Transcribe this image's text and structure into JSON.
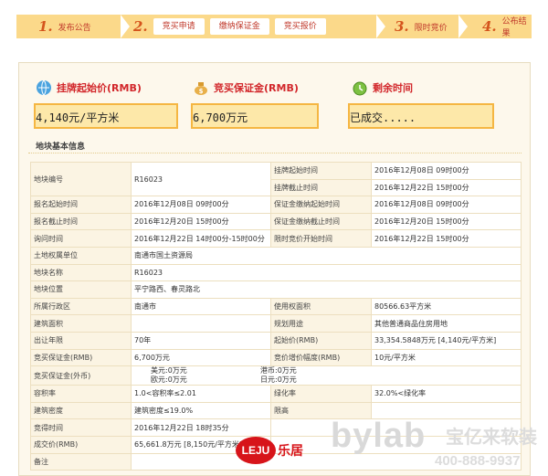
{
  "steps": [
    {
      "num": "1.",
      "label": "发布公告"
    },
    {
      "num": "2.",
      "label": ""
    },
    {
      "num": "3.",
      "label": "限时竞价"
    },
    {
      "num": "4.",
      "label": "公布结果"
    }
  ],
  "step2_buttons": [
    "竞买申请",
    "缴纳保证金",
    "竞买报价"
  ],
  "summary": {
    "start_price_title": "挂牌起始价(RMB)",
    "start_price_value": "4,140元/平方米",
    "deposit_title": "竞买保证金(RMB)",
    "deposit_value": "6,700万元",
    "remaining_title": "剩余时间",
    "remaining_value": "已成交....."
  },
  "section_title": "地块基本信息",
  "table": {
    "parcel_no_k": "地块编号",
    "parcel_no_v": "R16023",
    "list_start_k": "挂牌起始时间",
    "list_start_v": "2016年12月08日 09时00分",
    "list_end_k": "挂牌截止时间",
    "list_end_v": "2016年12月22日 15时00分",
    "reg_start_k": "报名起始时间",
    "reg_start_v": "2016年12月08日 09时00分",
    "dep_start_k": "保证金缴纳起始时间",
    "dep_start_v": "2016年12月08日 09时00分",
    "reg_end_k": "报名截止时间",
    "reg_end_v": "2016年12月20日 15时00分",
    "dep_end_k": "保证金缴纳截止时间",
    "dep_end_v": "2016年12月20日 15时00分",
    "inquiry_k": "询问时间",
    "inquiry_v": "2016年12月22日 14时00分-15时00分",
    "bid_start_k": "限时竞价开始时间",
    "bid_start_v": "2016年12月22日 15时00分",
    "owner_k": "土地权属单位",
    "owner_v": "南通市国土资源局",
    "name_k": "地块名称",
    "name_v": "R16023",
    "location_k": "地块位置",
    "location_v": "平宁路西、春灵路北",
    "district_k": "所属行政区",
    "district_v": "南通市",
    "use_area_k": "使用权面积",
    "use_area_v": "80566.63平方米",
    "build_area_k": "建筑面积",
    "build_area_v": "",
    "plan_use_k": "规划用途",
    "plan_use_v": "其他普通商品住房用地",
    "term_k": "出让年限",
    "term_v": "70年",
    "start_price_k": "起始价(RMB)",
    "start_price_v": "33,354.5848万元 [4,140元/平方米]",
    "deposit_k": "竞买保证金(RMB)",
    "deposit_v": "6,700万元",
    "increment_k": "竞价增价幅度(RMB)",
    "increment_v": "10元/平方米",
    "fx_k": "竞买保证金(外币)",
    "fx_usd": "美元:0万元",
    "fx_hkd": "港币:0万元",
    "fx_eur": "欧元:0万元",
    "fx_jpy": "日元:0万元",
    "far_k": "容积率",
    "far_v": "1.0<容积率≤2.01",
    "green_k": "绿化率",
    "green_v": "32.0%<绿化率",
    "density_k": "建筑密度",
    "density_v": "建筑密度≤19.0%",
    "height_k": "限高",
    "height_v": "",
    "deal_time_k": "竞得时间",
    "deal_time_v": "2016年12月22日 18时35分",
    "deal_price_k": "成交价(RMB)",
    "deal_price_v": "65,661.8万元 [8,150元/平方米]",
    "note_k": "备注",
    "note_v": ""
  },
  "watermarks": {
    "leju_logo": "LEJU",
    "leju_text": "乐居",
    "bylab_text": "bylab",
    "bylab_cn": "宝亿来软装",
    "bylab_tel": "400-888-9937"
  },
  "colors": {
    "accent": "#d2272b",
    "step_bg": "#fbd98a",
    "box_bg": "#fde8a9",
    "box_border": "#f5b642"
  }
}
